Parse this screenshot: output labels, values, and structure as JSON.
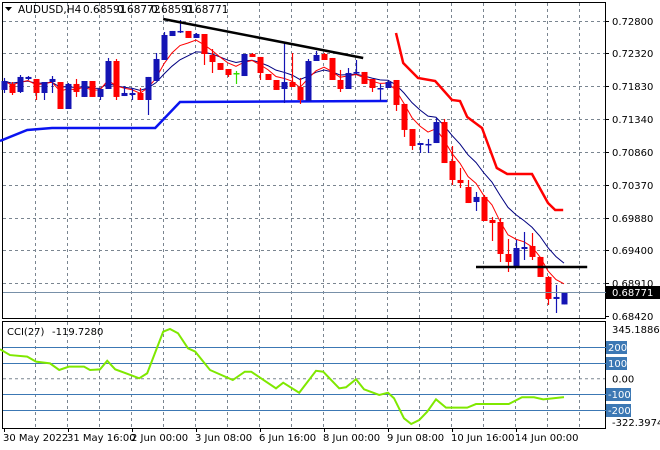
{
  "header": {
    "menu_icon": "triangle-down-icon",
    "symbol": "AUDUSD,H4",
    "open": "0.68591",
    "high": "0.68772",
    "low": "0.68591",
    "close": "0.68771"
  },
  "current_price_label": "0.68771",
  "colors": {
    "bull": "#1414b4",
    "bear": "#ff0000",
    "doji": "#33dd00",
    "ma_fast": "#ff0000",
    "ma_slow": "#000080",
    "upper_band": "#ff0000",
    "lower_band": "#0a14f0",
    "cci": "#7fe800",
    "level": "#3c78b4"
  },
  "chart_data": [
    {
      "type": "candlestick",
      "title": "AUDUSD,H4",
      "price_ticks": [
        "0.72800",
        "0.72320",
        "0.71830",
        "0.71340",
        "0.70860",
        "0.70370",
        "0.69880",
        "0.69400",
        "0.68910",
        "0.68420"
      ],
      "ylim": [
        0.6842,
        0.728
      ],
      "time_labels": [
        {
          "index": 0,
          "label": "30 May 2022"
        },
        {
          "index": 8,
          "label": "31 May 16:00"
        },
        {
          "index": 16,
          "label": "2 Jun 00:00"
        },
        {
          "index": 24,
          "label": "3 Jun 08:00"
        },
        {
          "index": 32,
          "label": "6 Jun 16:00"
        },
        {
          "index": 40,
          "label": "8 Jun 00:00"
        },
        {
          "index": 48,
          "label": "9 Jun 08:00"
        },
        {
          "index": 56,
          "label": "10 Jun 16:00"
        },
        {
          "index": 64,
          "label": "14 Jun 00:00"
        }
      ],
      "period_separators": [
        27.5,
        57.5
      ],
      "ohlc": [
        [
          0.71776,
          0.71954,
          0.71731,
          0.71909
        ],
        [
          0.71865,
          0.71894,
          0.71701,
          0.71731
        ],
        [
          0.71746,
          0.71998,
          0.71731,
          0.71969
        ],
        [
          0.71939,
          0.71983,
          0.71924,
          0.71969
        ],
        [
          0.71939,
          0.71939,
          0.71627,
          0.71731
        ],
        [
          0.71731,
          0.71894,
          0.71627,
          0.71894
        ],
        [
          0.71894,
          0.71983,
          0.71731,
          0.71939
        ],
        [
          0.71894,
          0.71894,
          0.71493,
          0.71493
        ],
        [
          0.71493,
          0.71879,
          0.71493,
          0.71865
        ],
        [
          0.71865,
          0.71939,
          0.71672,
          0.71746
        ],
        [
          0.71672,
          0.71909,
          0.71672,
          0.71909
        ],
        [
          0.71909,
          0.71909,
          0.71672,
          0.71672
        ],
        [
          0.71672,
          0.7179,
          0.71627,
          0.7179
        ],
        [
          0.7179,
          0.72251,
          0.7179,
          0.72206
        ],
        [
          0.72206,
          0.72236,
          0.71627,
          0.71672
        ],
        [
          0.71686,
          0.71835,
          0.71686,
          0.71731
        ],
        [
          0.71701,
          0.71805,
          0.71627,
          0.71731
        ],
        [
          0.71731,
          0.71805,
          0.71627,
          0.71627
        ],
        [
          0.71627,
          0.71969,
          0.71404,
          0.71969
        ],
        [
          0.71909,
          0.72325,
          0.71909,
          0.72236
        ],
        [
          0.72221,
          0.72637,
          0.72221,
          0.72592
        ],
        [
          0.72577,
          0.72652,
          0.72577,
          0.72652
        ],
        [
          0.72637,
          0.72815,
          0.72622,
          0.72652
        ],
        [
          0.72652,
          0.72652,
          0.72548,
          0.72548
        ],
        [
          0.72548,
          0.72622,
          0.72548,
          0.72607
        ],
        [
          0.72607,
          0.72607,
          0.72147,
          0.7231
        ],
        [
          0.72295,
          0.72384,
          0.72028,
          0.72191
        ],
        [
          0.72176,
          0.72176,
          0.72073,
          0.72073
        ],
        [
          0.72087,
          0.72087,
          0.71969,
          0.71998
        ],
        [
          0.72028,
          0.72058,
          0.71865,
          0.72028
        ],
        [
          0.71983,
          0.7231,
          0.71983,
          0.7231
        ],
        [
          0.7231,
          0.72325,
          0.72266,
          0.72266
        ],
        [
          0.72266,
          0.72266,
          0.71924,
          0.72028
        ],
        [
          0.72013,
          0.72013,
          0.71924,
          0.71924
        ],
        [
          0.71924,
          0.71924,
          0.71776,
          0.71776
        ],
        [
          0.7179,
          0.72473,
          0.71582,
          0.71894
        ],
        [
          0.71894,
          0.72325,
          0.7182,
          0.7182
        ],
        [
          0.7182,
          0.71954,
          0.71568,
          0.71627
        ],
        [
          0.71612,
          0.72236,
          0.71612,
          0.72206
        ],
        [
          0.72206,
          0.72355,
          0.72206,
          0.72295
        ],
        [
          0.7231,
          0.72325,
          0.72221,
          0.72221
        ],
        [
          0.72251,
          0.72251,
          0.71924,
          0.71924
        ],
        [
          0.71924,
          0.72073,
          0.71746,
          0.7179
        ],
        [
          0.7179,
          0.72102,
          0.7179,
          0.72028
        ],
        [
          0.72028,
          0.72221,
          0.72013,
          0.72043
        ],
        [
          0.72043,
          0.72043,
          0.71865,
          0.71865
        ],
        [
          0.71939,
          0.71939,
          0.71746,
          0.71805
        ],
        [
          0.7179,
          0.71865,
          0.71612,
          0.71805
        ],
        [
          0.71805,
          0.71909,
          0.71805,
          0.71894
        ],
        [
          0.71924,
          0.71924,
          0.71464,
          0.71553
        ],
        [
          0.71568,
          0.71568,
          0.71078,
          0.71182
        ],
        [
          0.71196,
          0.71196,
          0.70885,
          0.70944
        ],
        [
          0.70959,
          0.70988,
          0.7084,
          0.70988
        ],
        [
          0.70959,
          0.71048,
          0.7084,
          0.70974
        ],
        [
          0.70988,
          0.7136,
          0.70988,
          0.713
        ],
        [
          0.713,
          0.71345,
          0.70691,
          0.70691
        ],
        [
          0.70721,
          0.70944,
          0.70365,
          0.70439
        ],
        [
          0.70439,
          0.70617,
          0.7032,
          0.70394
        ],
        [
          0.70335,
          0.70439,
          0.70097,
          0.70097
        ],
        [
          0.70112,
          0.70261,
          0.69979,
          0.70187
        ],
        [
          0.70187,
          0.70216,
          0.6983,
          0.6983
        ],
        [
          0.69845,
          0.6989,
          0.69533,
          0.698
        ],
        [
          0.69815,
          0.69875,
          0.69221,
          0.6934
        ],
        [
          0.6934,
          0.69563,
          0.69073,
          0.69221
        ],
        [
          0.69162,
          0.69548,
          0.69147,
          0.69429
        ],
        [
          0.69414,
          0.69667,
          0.69251,
          0.69444
        ],
        [
          0.69459,
          0.69652,
          0.69251,
          0.69296
        ],
        [
          0.69296,
          0.69296,
          0.68999,
          0.68999
        ],
        [
          0.68999,
          0.69013,
          0.68583,
          0.68672
        ],
        [
          0.68672,
          0.6888,
          0.68464,
          0.68702
        ],
        [
          0.68591,
          0.68772,
          0.68591,
          0.68771
        ]
      ],
      "lower_band": [
        [
          -0.5,
          0.71018
        ],
        [
          2.9,
          0.71182
        ],
        [
          6,
          0.71211
        ],
        [
          18.9,
          0.71211
        ],
        [
          22,
          0.71597
        ],
        [
          47.9,
          0.71612
        ]
      ],
      "upper_band": [
        [
          49,
          0.72622
        ],
        [
          49.9,
          0.72176
        ],
        [
          51.75,
          0.71954
        ],
        [
          53.9,
          0.71909
        ],
        [
          56,
          0.71627
        ],
        [
          57,
          0.71612
        ],
        [
          57.9,
          0.71375
        ],
        [
          59.75,
          0.71211
        ],
        [
          61.6,
          0.70617
        ],
        [
          62.9,
          0.70528
        ],
        [
          66,
          0.70528
        ],
        [
          68,
          0.70097
        ],
        [
          68.9,
          0.69993
        ],
        [
          69.9,
          0.69993
        ]
      ],
      "trendlines": [
        {
          "from": [
            19.9,
            0.7283
          ],
          "to": [
            44.9,
            0.72251
          ]
        },
        {
          "from": [
            59,
            0.69147
          ],
          "to": [
            72.9,
            0.69147
          ]
        }
      ]
    },
    {
      "type": "line",
      "title": "CCI(27)",
      "value_label": "-119.7280",
      "scale_max": "345.1886",
      "scale_min": "-322.3974",
      "ylim": [
        -322.3974,
        345.1886
      ],
      "levels": [
        "200",
        "100",
        "-100",
        "-200"
      ],
      "zero_label": "0.00",
      "points": [
        [
          -0.5,
          185
        ],
        [
          0.75,
          148
        ],
        [
          2.9,
          138
        ],
        [
          4,
          106
        ],
        [
          5.75,
          95
        ],
        [
          6.9,
          53
        ],
        [
          8.1,
          74
        ],
        [
          10,
          74
        ],
        [
          10.75,
          53
        ],
        [
          12,
          57
        ],
        [
          12.9,
          112
        ],
        [
          13.9,
          57
        ],
        [
          15.25,
          32
        ],
        [
          16.9,
          0
        ],
        [
          17.9,
          32
        ],
        [
          19.9,
          297
        ],
        [
          20.75,
          314
        ],
        [
          21.75,
          287
        ],
        [
          23,
          191
        ],
        [
          23.9,
          170
        ],
        [
          25.75,
          53
        ],
        [
          28.6,
          -11
        ],
        [
          30.1,
          42
        ],
        [
          30.9,
          42
        ],
        [
          34,
          -64
        ],
        [
          34.9,
          -28
        ],
        [
          36.9,
          -92
        ],
        [
          39,
          48
        ],
        [
          39.9,
          42
        ],
        [
          41.9,
          -64
        ],
        [
          42.75,
          -57
        ],
        [
          44,
          -6
        ],
        [
          45,
          -70
        ],
        [
          46.9,
          -106
        ],
        [
          48,
          -92
        ],
        [
          48.75,
          -127
        ],
        [
          50,
          -255
        ],
        [
          50.9,
          -291
        ],
        [
          51.9,
          -266
        ],
        [
          52.9,
          -213
        ],
        [
          54,
          -134
        ],
        [
          55.25,
          -187
        ],
        [
          57.9,
          -187
        ],
        [
          59,
          -164
        ],
        [
          63.1,
          -164
        ],
        [
          64.75,
          -121
        ],
        [
          66.25,
          -121
        ],
        [
          67.4,
          -134
        ],
        [
          70,
          -119.728
        ]
      ]
    }
  ]
}
